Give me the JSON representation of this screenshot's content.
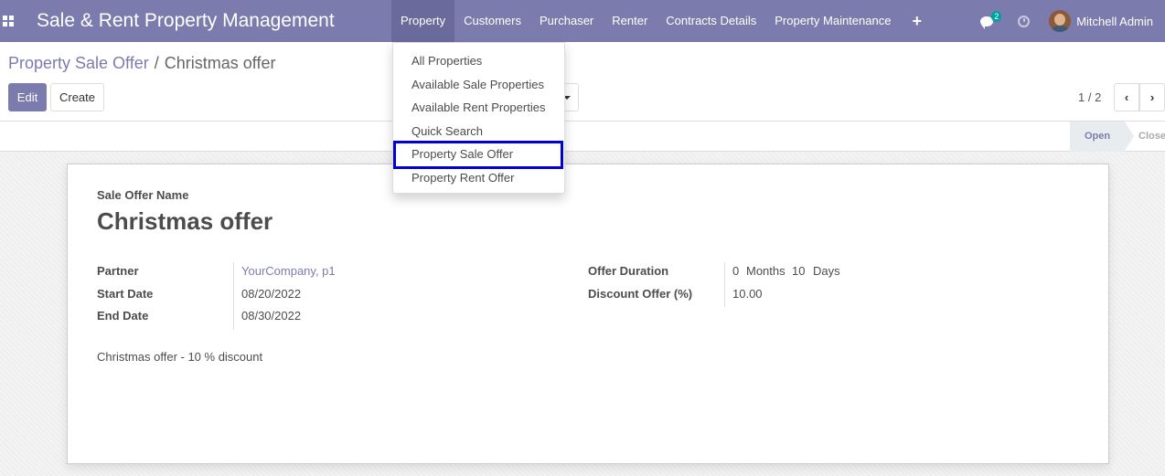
{
  "navbar": {
    "brand": "Sale & Rent Property Management",
    "menu": [
      "Property",
      "Customers",
      "Purchaser",
      "Renter",
      "Contracts Details",
      "Property Maintenance"
    ],
    "plus": "+",
    "chat_count": "2",
    "user_name": "Mitchell Admin"
  },
  "breadcrumb": {
    "parent": "Property Sale Offer",
    "separator": "/",
    "current": "Christmas offer"
  },
  "buttons": {
    "edit": "Edit",
    "create": "Create"
  },
  "pager": {
    "value": "1 / 2",
    "prev": "‹",
    "next": "›"
  },
  "statusbar": {
    "open": "Open",
    "close": "Close"
  },
  "dropdown": {
    "items": [
      "All Properties",
      "Available Sale Properties",
      "Available Rent Properties",
      "Quick Search",
      "Property Sale Offer",
      "Property Rent Offer"
    ],
    "highlighted": "Property Sale Offer"
  },
  "form": {
    "name_label": "Sale Offer Name",
    "name_value": "Christmas offer",
    "left": [
      {
        "label": "Partner",
        "value": "YourCompany, p1"
      },
      {
        "label": "Start Date",
        "value": "08/20/2022"
      },
      {
        "label": "End Date",
        "value": "08/30/2022"
      }
    ],
    "right": {
      "duration_label": "Offer Duration",
      "months_value": "0",
      "months_unit": "Months",
      "days_value": "10",
      "days_unit": "Days",
      "discount_label": "Discount Offer (%)",
      "discount_value": "10.00"
    },
    "notes": "Christmas offer - 10 % discount"
  },
  "colors": {
    "brand": "#7c7bad",
    "highlight": "#0000d6"
  }
}
